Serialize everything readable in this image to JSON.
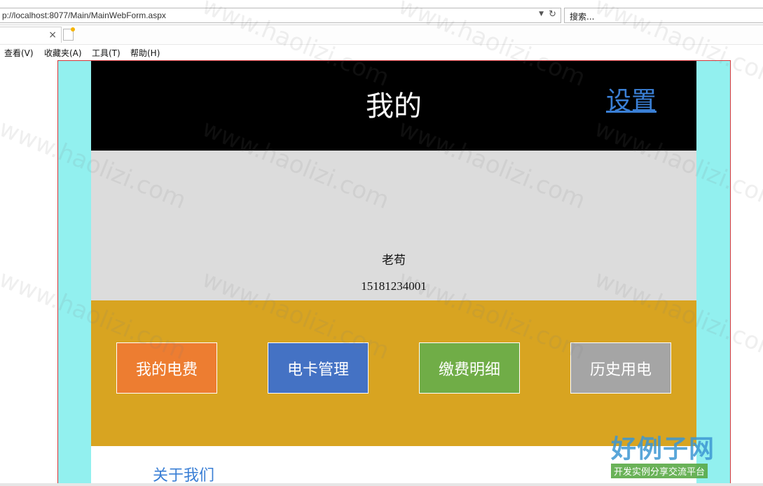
{
  "browser": {
    "url": "p://localhost:8077/Main/MainWebForm.aspx",
    "search_placeholder": "搜索...",
    "tab_close": "×",
    "menu": [
      "查看(V)",
      "收藏夹(A)",
      "工具(T)",
      "帮助(H)"
    ]
  },
  "page": {
    "title": "我的",
    "settings_label": "设置",
    "profile": {
      "name": "老苟",
      "phone": "15181234001"
    },
    "actions": [
      {
        "label": "我的电费",
        "color": "#ed7d31"
      },
      {
        "label": "电卡管理",
        "color": "#4472c4"
      },
      {
        "label": "缴费明细",
        "color": "#70ad47"
      },
      {
        "label": "历史用电",
        "color": "#a5a5a5"
      }
    ],
    "about_label": "关于我们"
  },
  "colors": {
    "side_background": "#92f0ef",
    "header_background": "#000000",
    "profile_background": "#dcdcdc",
    "actions_background": "#d8a421",
    "link": "#3a7fd5"
  },
  "watermark": {
    "text": "www.haolizi.com",
    "logo_main": "好例子网",
    "logo_sub": "开发实例分享交流平台"
  }
}
